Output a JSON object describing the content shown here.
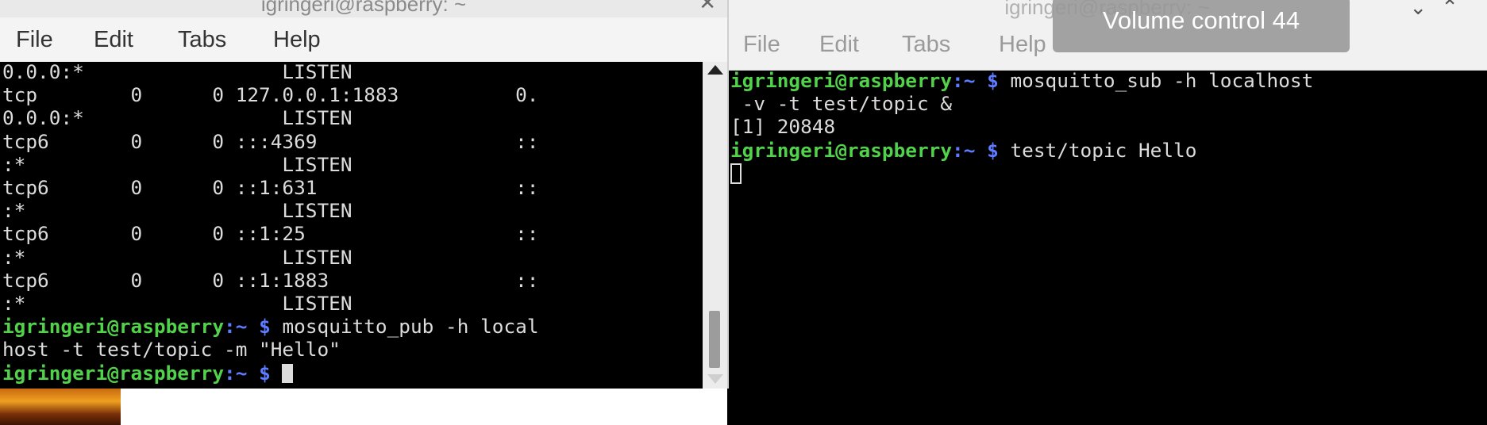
{
  "left_window": {
    "title": "igringeri@raspberry: ~",
    "menu": [
      "File",
      "Edit",
      "Tabs",
      "Help"
    ],
    "lines": [
      [
        {
          "t": "0.0.0:*                 LISTEN"
        }
      ],
      [
        {
          "t": "tcp        0      0 127.0.0.1:1883          0."
        }
      ],
      [
        {
          "t": "0.0.0:*                 LISTEN"
        }
      ],
      [
        {
          "t": "tcp6       0      0 :::4369                 ::"
        }
      ],
      [
        {
          "t": ":*                      LISTEN"
        }
      ],
      [
        {
          "t": "tcp6       0      0 ::1:631                 ::"
        }
      ],
      [
        {
          "t": ":*                      LISTEN"
        }
      ],
      [
        {
          "t": "tcp6       0      0 ::1:25                  ::"
        }
      ],
      [
        {
          "t": ":*                      LISTEN"
        }
      ],
      [
        {
          "t": "tcp6       0      0 ::1:1883                ::"
        }
      ],
      [
        {
          "t": ":*                      LISTEN"
        }
      ],
      [
        {
          "t": "igringeri@raspberry",
          "c": "user"
        },
        {
          "t": ":~ $ ",
          "c": "path"
        },
        {
          "t": "mosquitto_pub -h local"
        }
      ],
      [
        {
          "t": "host -t test/topic -m \"Hello\""
        }
      ],
      [
        {
          "t": "igringeri@raspberry",
          "c": "user"
        },
        {
          "t": ":~ $ ",
          "c": "path"
        },
        {
          "t": "",
          "c": "cursor-block"
        }
      ]
    ]
  },
  "right_window": {
    "title": "igringeri@raspberry: ~",
    "menu": [
      "File",
      "Edit",
      "Tabs",
      "Help"
    ],
    "lines": [
      [
        {
          "t": "igringeri@raspberry",
          "c": "user"
        },
        {
          "t": ":~ $ ",
          "c": "path"
        },
        {
          "t": "mosquitto_sub -h localhost"
        }
      ],
      [
        {
          "t": " -v -t test/topic &"
        }
      ],
      [
        {
          "t": "[1] 20848"
        }
      ],
      [
        {
          "t": "igringeri@raspberry",
          "c": "user"
        },
        {
          "t": ":~ $ ",
          "c": "path"
        },
        {
          "t": "test/topic Hello"
        }
      ],
      [
        {
          "t": "",
          "c": "cursor-hollow"
        }
      ]
    ]
  },
  "osd": {
    "label": "Volume control 44",
    "volume": 44
  }
}
